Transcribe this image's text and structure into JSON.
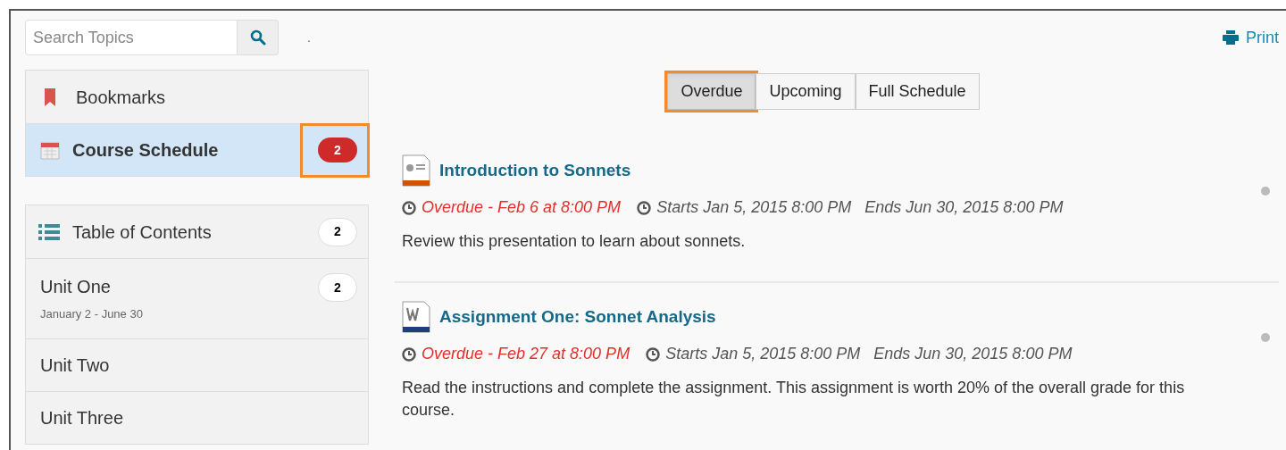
{
  "search": {
    "placeholder": "Search Topics"
  },
  "stray_mark": ".",
  "print_link": "Print",
  "nav": [
    {
      "label": "Bookmarks",
      "kind": "bookmark",
      "selected": false
    },
    {
      "label": "Course Schedule",
      "kind": "calendar",
      "selected": true,
      "count": "2",
      "highlighted": true
    }
  ],
  "toc": {
    "label": "Table of Contents",
    "count": "2",
    "units": [
      {
        "label": "Unit One",
        "dates": "January 2 - June 30",
        "count": "2"
      },
      {
        "label": "Unit Two"
      },
      {
        "label": "Unit Three"
      }
    ]
  },
  "tabs": [
    {
      "label": "Overdue",
      "selected": true,
      "highlighted": true
    },
    {
      "label": "Upcoming",
      "selected": false,
      "highlighted": false
    },
    {
      "label": "Full Schedule",
      "selected": false,
      "highlighted": false
    }
  ],
  "items": [
    {
      "kind": "presentation",
      "title": "Introduction to Sonnets",
      "due": "Overdue - Feb 6 at 8:00 PM",
      "dates": "Starts Jan 5, 2015 8:00 PM   Ends Jun 30, 2015 8:00 PM",
      "description": "Review this presentation to learn about sonnets."
    },
    {
      "kind": "document",
      "title": "Assignment One: Sonnet Analysis",
      "due": "Overdue - Feb 27 at 8:00 PM",
      "dates": "Starts Jan 5, 2015 8:00 PM   Ends Jun 30, 2015 8:00 PM",
      "description": "Read the instructions and complete the assignment. This assignment is worth 20% of the overall grade for this course."
    }
  ]
}
